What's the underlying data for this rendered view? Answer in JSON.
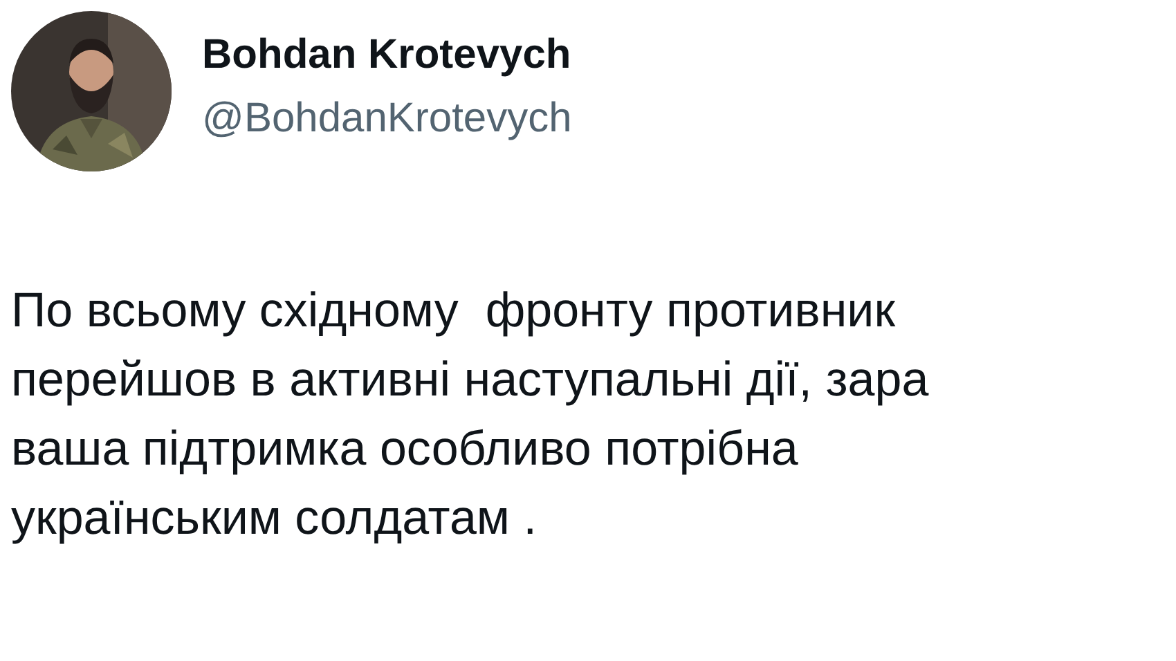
{
  "tweet": {
    "author_name": "Bohdan Krotevych",
    "handle": "@BohdanKrotevych",
    "text": "По всьому східному  фронту противник\nперейшов в активні наступальні дії, зара\nваша підтримка особливо потрібна\nукраїнським солдатам ."
  }
}
